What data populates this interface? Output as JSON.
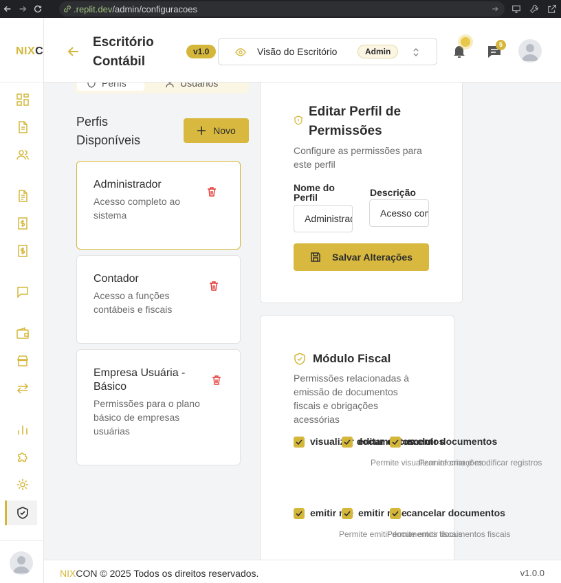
{
  "browser": {
    "url_host": ".replit.dev",
    "url_path": "/admin/configuracoes"
  },
  "brand": {
    "part1": "NIX",
    "part2": "CON"
  },
  "header": {
    "title": "Escritório Contábil",
    "version": "v1.0",
    "view_label": "Visão do Escritório",
    "role_badge": "Admin",
    "message_count": "5"
  },
  "tabs": [
    {
      "label": "Perfis"
    },
    {
      "label": "Usuários"
    }
  ],
  "profiles_list": {
    "title": "Perfis Disponíveis",
    "new_button": "Novo",
    "items": [
      {
        "name": "Administrador",
        "description": "Acesso completo ao sistema"
      },
      {
        "name": "Contador",
        "description": "Acesso a funções contábeis e fiscais"
      },
      {
        "name": "Empresa Usuária - Básico",
        "description": "Permissões para o plano básico de empresas usuárias"
      }
    ]
  },
  "edit_profile": {
    "title": "Editar Perfil de Permissões",
    "subtitle": "Configure as permissões para este perfil",
    "name_label": "Nome do Perfil",
    "name_value": "Administrador",
    "description_label": "Descrição",
    "description_value": "Acesso completo ao sistema",
    "save_button": "Salvar Alterações"
  },
  "module": {
    "title": "Módulo Fiscal",
    "subtitle": "Permissões relacionadas à emissão de documentos fiscais e obrigações acessórias",
    "permissions": [
      {
        "label": "visualizar documentos",
        "description": "Permite visualizar informações",
        "checked": true
      },
      {
        "label": "editar documentos",
        "description": "Permite criar e modificar registros",
        "checked": true
      },
      {
        "label": "excluir documentos",
        "description": "Permite excluir registros",
        "checked": true
      },
      {
        "label": "emitir nfe",
        "description": "Permite emitir documentos fiscais",
        "checked": true
      },
      {
        "label": "emitir nfse",
        "description": "Permite emitir documentos fiscais",
        "checked": true
      },
      {
        "label": "cancelar documentos",
        "description": "Permite cancelar documentos",
        "checked": true
      }
    ]
  },
  "footer": {
    "brand1": "NIX",
    "brand2": "CON",
    "copyright": " © 2025 Todos os direitos reservados.",
    "version": "v1.0.0"
  },
  "colors": {
    "accent": "#d4b73a",
    "danger": "#e53935"
  },
  "sidebar_icons": [
    "dashboard-icon",
    "document-icon",
    "users-icon",
    "file-text-icon",
    "dollar-file-icon",
    "dollar-file-icon",
    "chat-icon",
    "wallet-icon",
    "store-icon",
    "transfer-icon",
    "bar-chart-icon",
    "puzzle-icon",
    "gear-icon",
    "shield-check-icon"
  ]
}
